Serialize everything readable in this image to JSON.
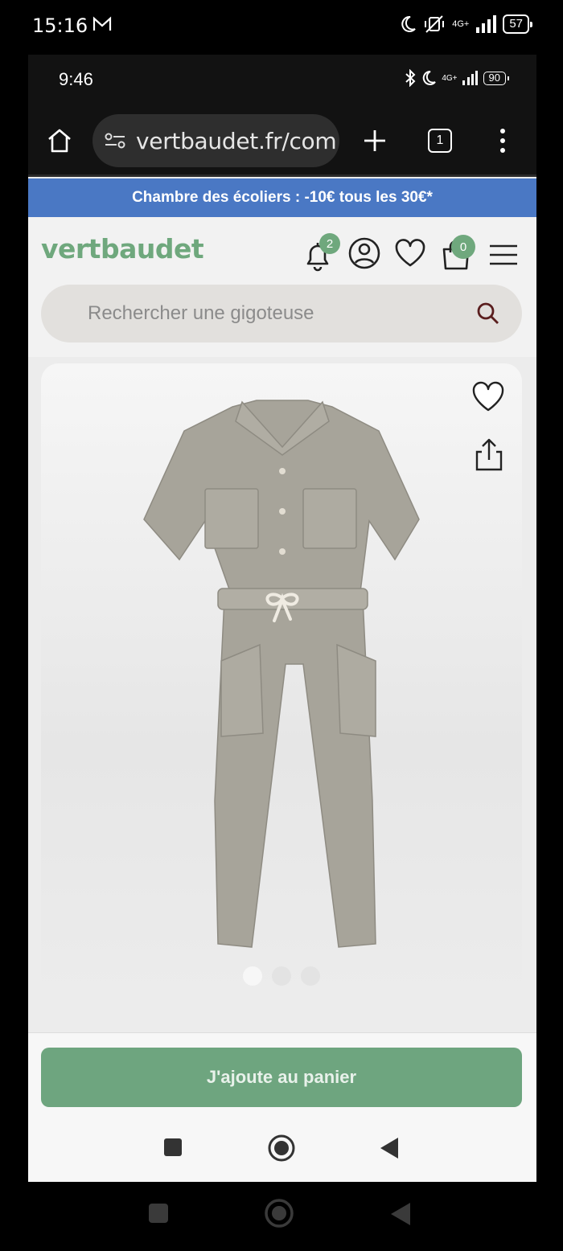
{
  "outer_status": {
    "time": "15:16",
    "network": "4G+",
    "battery": "57"
  },
  "inner_status": {
    "time": "9:46",
    "network": "4G+",
    "battery": "90"
  },
  "browser": {
    "url": "vertbaudet.fr/com",
    "tab_count": "1"
  },
  "promo": {
    "text": "Chambre des écoliers : -10€ tous les 30€*"
  },
  "header": {
    "logo": "vertbaudet",
    "notifications_count": "2",
    "cart_count": "0"
  },
  "search": {
    "placeholder": "Rechercher une gigoteuse"
  },
  "product": {
    "image_count": 3,
    "active_image": 1
  },
  "footer": {
    "add_to_cart": "J'ajoute au panier"
  },
  "colors": {
    "brand": "#6fa87d",
    "promo": "#4a78c4",
    "cta": "#6ea57f"
  }
}
